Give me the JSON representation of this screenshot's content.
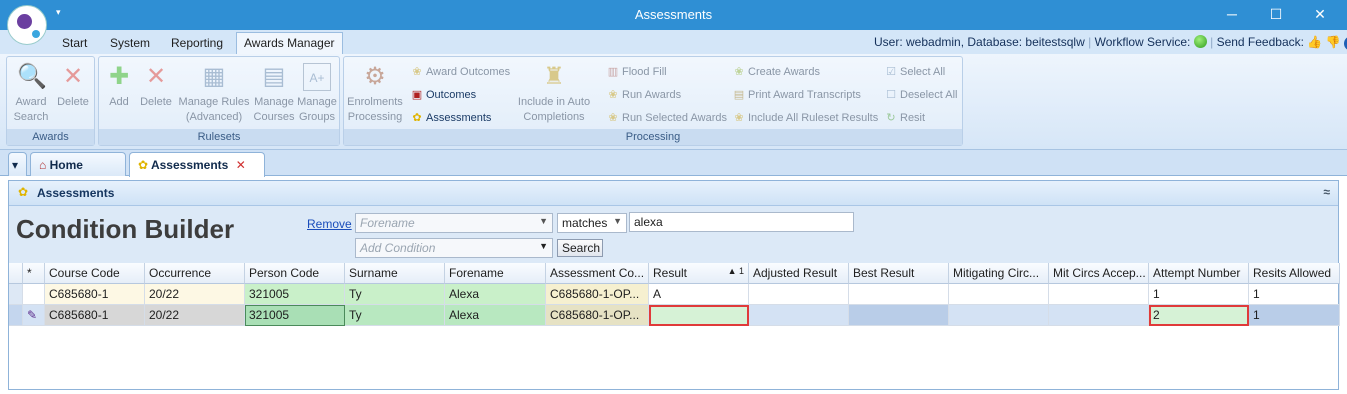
{
  "window": {
    "title": "Assessments",
    "quick_access": "▾",
    "minimize": "─",
    "maximize": "☐",
    "close": "✕"
  },
  "ribbon_tabs": [
    "Start",
    "System",
    "Reporting",
    "Awards Manager"
  ],
  "user_info": {
    "user": "User: webadmin, Database: beitestsqlw",
    "sep1": "|",
    "workflow": "Workflow Service:",
    "sep2": "|",
    "feedback": "Send Feedback:",
    "help": "?"
  },
  "ribbon": {
    "awards": {
      "label": "Awards",
      "search": "Award\nSearch",
      "delete": "Delete"
    },
    "rulesets": {
      "label": "Rulesets",
      "add": "Add",
      "delete": "Delete",
      "manage_rules": "Manage Rules\n(Advanced)",
      "manage_courses": "Manage\nCourses",
      "manage_groups": "Manage\nGroups"
    },
    "processing": {
      "label": "Processing",
      "enrolments": "Enrolments\nProcessing",
      "award_outcomes": "Award Outcomes",
      "outcomes": "Outcomes",
      "assessments": "Assessments",
      "include_auto": "Include in Auto\nCompletions",
      "flood_fill": "Flood Fill",
      "run_awards": "Run Awards",
      "run_selected": "Run Selected Awards",
      "create_awards": "Create Awards",
      "print_transcripts": "Print Award Transcripts",
      "include_all": "Include All Ruleset Results",
      "select_all": "Select All",
      "deselect_all": "Deselect All",
      "resit": "Resit"
    }
  },
  "doc_tabs": {
    "dropdown": "▾",
    "home": "Home",
    "assessments": "Assessments",
    "close": "✕"
  },
  "panel": {
    "title": "Assessments",
    "collapse": "≈"
  },
  "condition_builder": {
    "title": "Condition Builder",
    "remove": "Remove",
    "field_placeholder": "Forename",
    "operator": "matches",
    "value": "alexa",
    "add_condition": "Add Condition",
    "search": "Search"
  },
  "grid": {
    "columns": [
      "*",
      "Course Code",
      "Occurrence",
      "Person Code",
      "Surname",
      "Forename",
      "Assessment Co...",
      "Result",
      "Adjusted Result",
      "Best Result",
      "Mitigating Circ...",
      "Mit Circs Accep...",
      "Attempt Number",
      "Resits Allowed"
    ],
    "sort_indicator": "▲ 1",
    "rows": [
      [
        "",
        "C685680-1",
        "20/22",
        "321005",
        "Ty",
        "Alexa",
        "C685680-1-OP...",
        "A",
        "",
        "",
        "",
        "",
        "1",
        "1"
      ],
      [
        "✎",
        "C685680-1",
        "20/22",
        "321005",
        "Ty",
        "Alexa",
        "C685680-1-OP...",
        "",
        "",
        "",
        "",
        "",
        "2",
        "1"
      ]
    ]
  },
  "colors": {
    "titlebar": "#2f8fd4",
    "row1_person": "#c9f0c9",
    "row1_assess": "#f6f0d0",
    "row2": "#d4e2f4",
    "highlight": "#e03a3a"
  }
}
